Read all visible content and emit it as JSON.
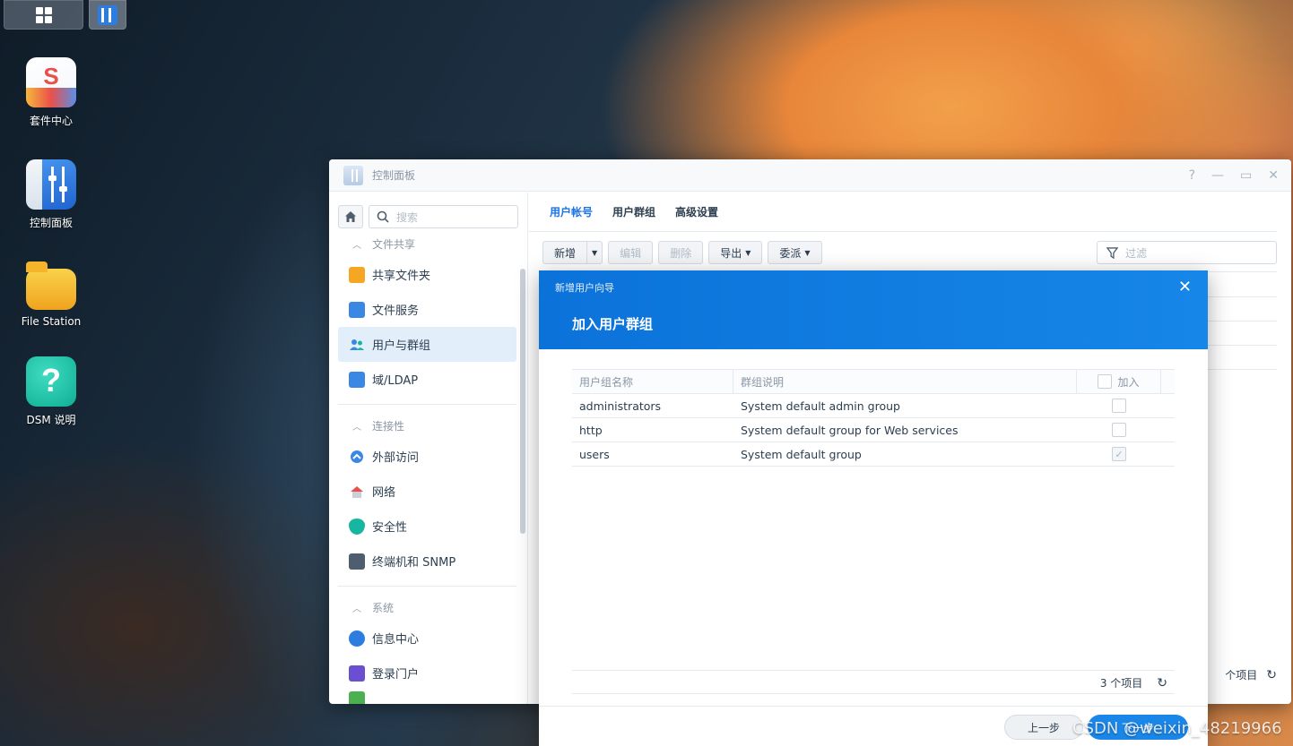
{
  "desktop": {
    "icons": [
      {
        "label": "套件中心"
      },
      {
        "label": "控制面板"
      },
      {
        "label": "File Station"
      },
      {
        "label": "DSM 说明"
      }
    ]
  },
  "window": {
    "title": "控制面板",
    "controls": [
      "?",
      "—",
      "▭",
      "✕"
    ],
    "search_placeholder": "搜索",
    "sidebar": {
      "sections": [
        {
          "label": "文件共享",
          "items": [
            {
              "label": "共享文件夹",
              "icon": "shared-folder-icon",
              "active": false
            },
            {
              "label": "文件服务",
              "icon": "file-services-icon",
              "active": false
            },
            {
              "label": "用户与群组",
              "icon": "users-groups-icon",
              "active": true
            },
            {
              "label": "域/LDAP",
              "icon": "domain-ldap-icon",
              "active": false
            }
          ]
        },
        {
          "label": "连接性",
          "items": [
            {
              "label": "外部访问",
              "icon": "external-access-icon",
              "active": false
            },
            {
              "label": "网络",
              "icon": "network-icon",
              "active": false
            },
            {
              "label": "安全性",
              "icon": "security-icon",
              "active": false
            },
            {
              "label": "终端机和 SNMP",
              "icon": "terminal-icon",
              "active": false
            }
          ]
        },
        {
          "label": "系统",
          "items": [
            {
              "label": "信息中心",
              "icon": "info-center-icon",
              "active": false
            },
            {
              "label": "登录门户",
              "icon": "login-portal-icon",
              "active": false
            }
          ]
        }
      ]
    },
    "tabs": [
      {
        "label": "用户帐号",
        "active": true
      },
      {
        "label": "用户群组",
        "active": false
      },
      {
        "label": "高级设置",
        "active": false
      }
    ],
    "toolbar": {
      "create": "新增",
      "edit": "编辑",
      "delete": "删除",
      "export": "导出",
      "delegate": "委派"
    },
    "filter_placeholder": "过滤",
    "footer_count": "个项目"
  },
  "dialog": {
    "wizard_title": "新增用户向导",
    "step_title": "加入用户群组",
    "columns": {
      "name": "用户组名称",
      "description": "群组说明",
      "join": "加入"
    },
    "rows": [
      {
        "name": "administrators",
        "description": "System default admin group",
        "joined": false
      },
      {
        "name": "http",
        "description": "System default group for Web services",
        "joined": false
      },
      {
        "name": "users",
        "description": "System default group",
        "joined": true
      }
    ],
    "count": "3 个项目",
    "prev_button": "上一步",
    "next_button": "下一步"
  },
  "watermark": "CSDN @weixin_48219966",
  "colors": {
    "accent": "#1a73e8",
    "dialog_header": "#0b72d9",
    "active_item_bg": "#e3eefb"
  }
}
